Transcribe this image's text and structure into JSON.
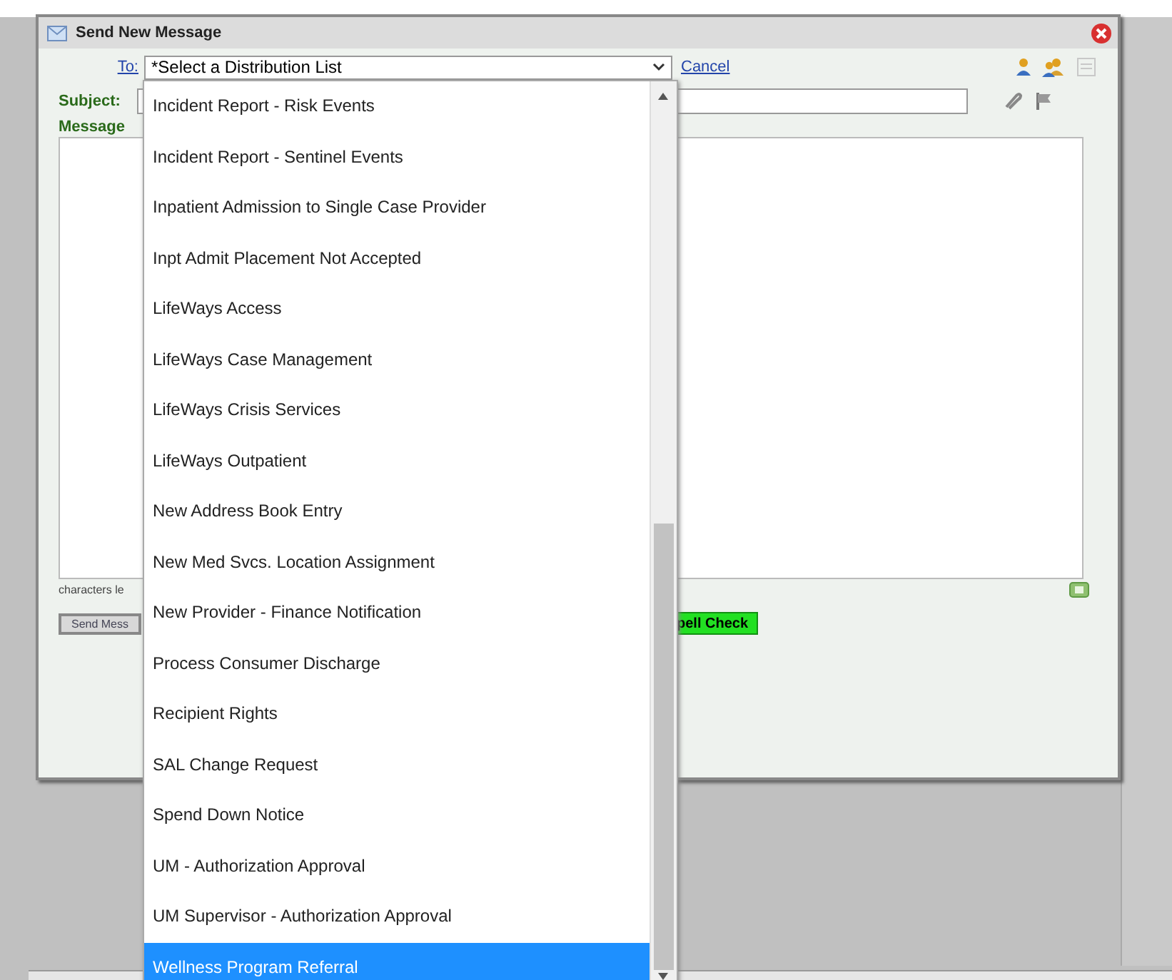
{
  "dialog": {
    "title": "Send New Message",
    "to_label": "To:",
    "to_select": "*Select a Distribution List",
    "cancel_link": "Cancel",
    "subject_label": "Subject:",
    "message_label": "Message",
    "chars_left": "characters le",
    "send_button": "Send Mess",
    "spell_button": "pell Check"
  },
  "dropdown": {
    "items": [
      {
        "label": "Incident Report - Risk Events",
        "selected": false
      },
      {
        "label": "Incident Report - Sentinel Events",
        "selected": false
      },
      {
        "label": "Inpatient Admission to Single Case Provider",
        "selected": false
      },
      {
        "label": "Inpt Admit Placement Not Accepted",
        "selected": false
      },
      {
        "label": "LifeWays Access",
        "selected": false
      },
      {
        "label": "LifeWays Case Management",
        "selected": false
      },
      {
        "label": "LifeWays Crisis Services",
        "selected": false
      },
      {
        "label": "LifeWays Outpatient",
        "selected": false
      },
      {
        "label": "New Address Book Entry",
        "selected": false
      },
      {
        "label": "New Med Svcs. Location Assignment",
        "selected": false
      },
      {
        "label": "New Provider - Finance Notification",
        "selected": false
      },
      {
        "label": "Process Consumer Discharge",
        "selected": false
      },
      {
        "label": "Recipient Rights",
        "selected": false
      },
      {
        "label": "SAL Change Request",
        "selected": false
      },
      {
        "label": "Spend Down Notice",
        "selected": false
      },
      {
        "label": "UM - Authorization Approval",
        "selected": false
      },
      {
        "label": "UM Supervisor - Authorization Approval",
        "selected": false
      },
      {
        "label": "Wellness Program Referral",
        "selected": true
      }
    ]
  }
}
